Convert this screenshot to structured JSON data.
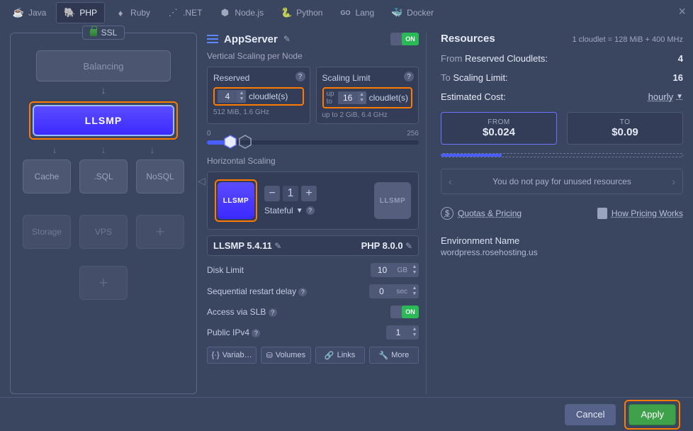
{
  "tabs": {
    "java": "Java",
    "php": "PHP",
    "ruby": "Ruby",
    "dotnet": ".NET",
    "node": "Node.js",
    "python": "Python",
    "go": "Lang",
    "docker": "Docker"
  },
  "ssl_label": "SSL",
  "topology": {
    "balancing": "Balancing",
    "app_label": "LLSMP",
    "cache": "Cache",
    "sql": ".SQL",
    "nosql": "NoSQL",
    "storage": "Storage",
    "vps": "VPS"
  },
  "mid": {
    "title": "AppServer",
    "toggle_on": "ON",
    "vertical": "Vertical Scaling per Node",
    "reserved": {
      "title": "Reserved",
      "value": "4",
      "unit": "cloudlet(s)",
      "sub": "512 MiB, 1.6 GHz"
    },
    "limit": {
      "title": "Scaling Limit",
      "prefix": "up to",
      "value": "16",
      "unit": "cloudlet(s)",
      "sub": "2 GiB, 6.4 GHz"
    },
    "slider_min": "0",
    "slider_max": "256",
    "horizontal": "Horizontal Scaling",
    "count": "1",
    "stateful": "Stateful",
    "version_left": "LLSMP 5.4.11",
    "version_right": "PHP 8.0.0",
    "disk": "Disk Limit",
    "disk_val": "10",
    "disk_unit": "GB",
    "restart": "Sequential restart delay",
    "restart_val": "0",
    "restart_unit": "sec",
    "slb": "Access via SLB",
    "ipv4": "Public IPv4",
    "ipv4_val": "1",
    "buttons": {
      "variables": "Variab…",
      "volumes": "Volumes",
      "links": "Links",
      "more": "More"
    }
  },
  "right": {
    "title": "Resources",
    "cloudlet_def": "1 cloudlet = 128 MiB + 400 MHz",
    "from_label": "From",
    "reserved_label": "Reserved Cloudlets:",
    "reserved_val": "4",
    "to_label": "To",
    "limit_label": "Scaling Limit:",
    "limit_val": "16",
    "cost_label": "Estimated Cost:",
    "period": "hourly",
    "from_box": "FROM",
    "from_price": "$0.024",
    "to_box": "TO",
    "to_price": "$0.09",
    "carousel": "You do not pay for unused resources",
    "quotas": "Quotas & Pricing",
    "how": "How Pricing Works",
    "env_title": "Environment Name",
    "env_value": "wordpress.rosehosting.us"
  },
  "footer": {
    "cancel": "Cancel",
    "apply": "Apply"
  }
}
